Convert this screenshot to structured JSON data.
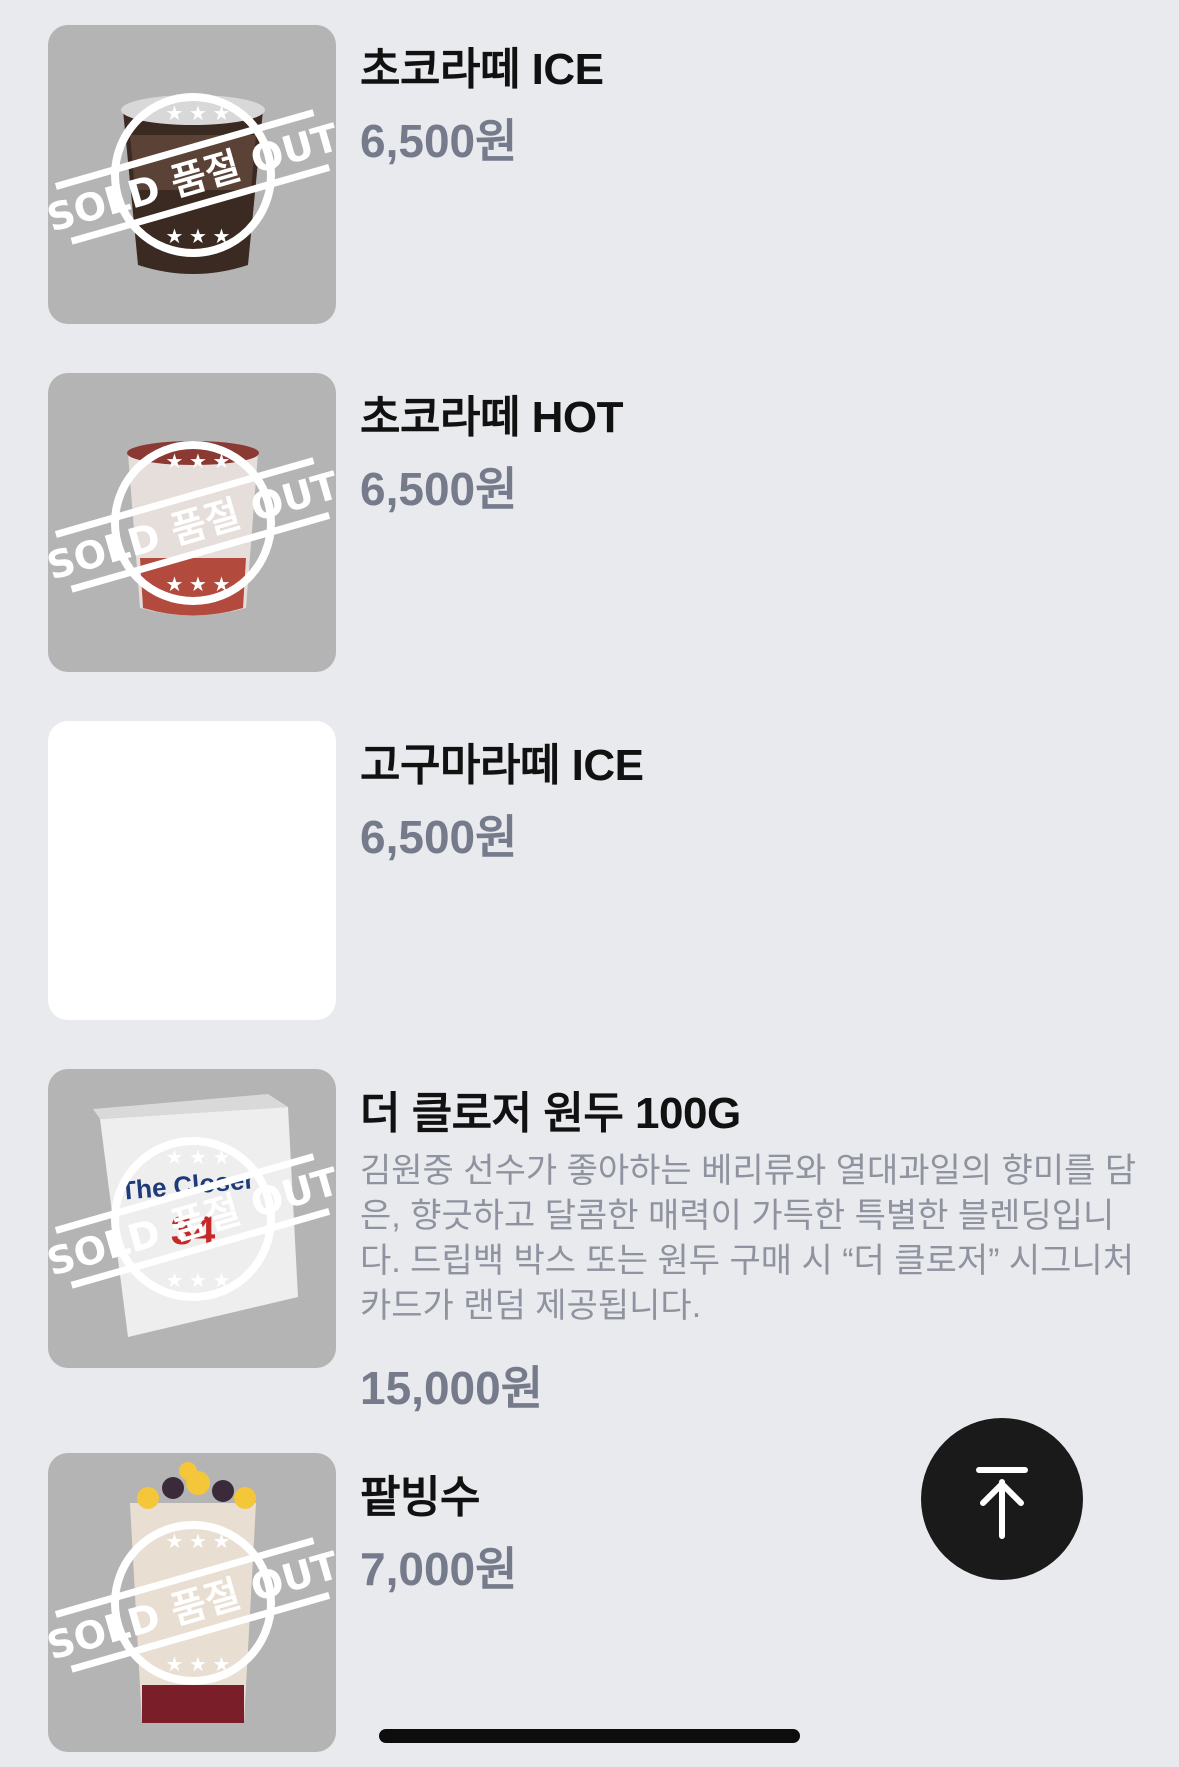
{
  "sold_out_stamp": {
    "left_text": "SOLD",
    "center_text": "품절",
    "right_text": "OUT"
  },
  "menu_items": [
    {
      "name": "초코라떼 ICE",
      "price": "6,500원",
      "sold_out": true,
      "image": "chocolate-latte-ice-cup"
    },
    {
      "name": "초코라떼 HOT",
      "price": "6,500원",
      "sold_out": true,
      "image": "chocolate-latte-hot-cup"
    },
    {
      "name": "고구마라떼 ICE",
      "price": "6,500원",
      "sold_out": false,
      "image": "blank"
    },
    {
      "name": "더 클로저 원두 100G",
      "description": "김원중 선수가 좋아하는 베리류와 열대과일의 향미를 담은, 향긋하고 달콤한 매력이 가득한 특별한 블렌딩입니다. 드립백 박스 또는 원두 구매 시 “더 클로저” 시그니처 카드가 랜덤 제공됩니다.",
      "price": "15,000원",
      "sold_out": true,
      "image": "coffee-bean-box"
    },
    {
      "name": "팥빙수",
      "price": "7,000원",
      "sold_out": true,
      "image": "red-bean-bingsu-cup"
    }
  ],
  "scroll_top_button": {
    "icon": "arrow-up-to-top-icon"
  },
  "colors": {
    "background": "#e9eaee",
    "name": "#111111",
    "price": "#767b8c",
    "description": "#8f939f",
    "button": "#1a1a1a"
  }
}
